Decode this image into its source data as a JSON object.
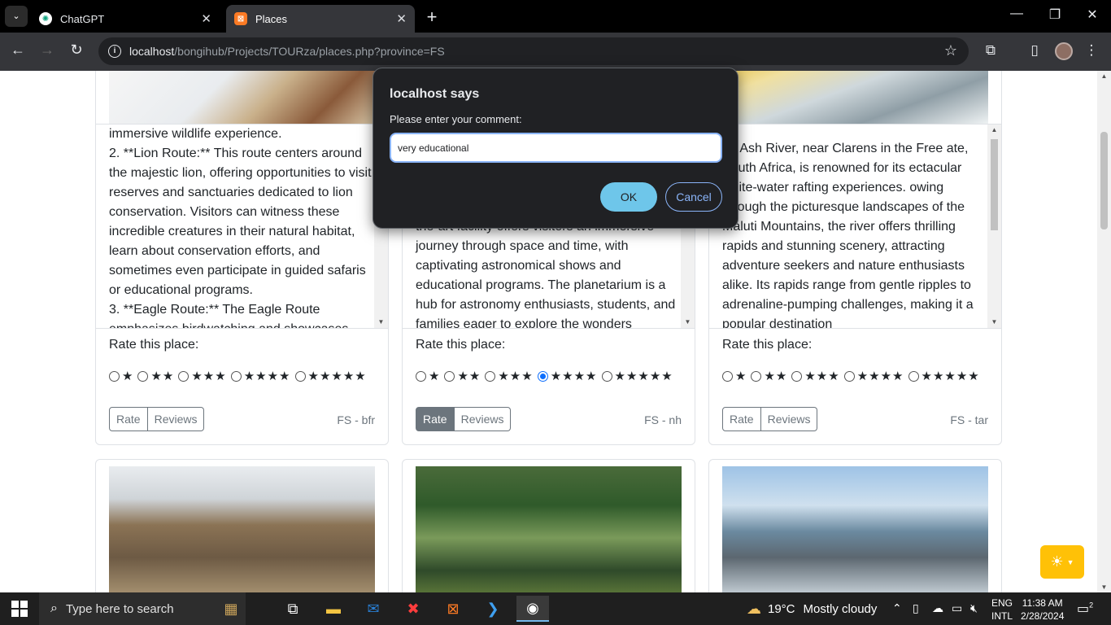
{
  "browser": {
    "tabs": [
      {
        "title": "ChatGPT",
        "icon": "chatgpt-icon"
      },
      {
        "title": "Places",
        "icon": "xampp-icon"
      }
    ],
    "url_host": "localhost",
    "url_path": "/bongihub/Projects/TOURza/places.php?province=FS"
  },
  "dialog": {
    "title": "localhost says",
    "message": "Please enter your comment:",
    "input_value": "very educational",
    "ok_label": "OK",
    "cancel_label": "Cancel"
  },
  "cards": [
    {
      "description": "immersive wildlife experience.\n2. **Lion Route:** This route centers around the majestic lion, offering opportunities to visit reserves and sanctuaries dedicated to lion conservation. Visitors can witness these incredible creatures in their natural habitat, learn about conservation efforts, and sometimes even participate in guided safaris or educational programs.\n3. **Eagle Route:** The Eagle Route emphasizes birdwatching and showcases",
      "rate_label": "Rate this place:",
      "rating_options": [
        "★",
        "★★",
        "★★★",
        "★★★★",
        "★★★★★"
      ],
      "selected_rating": null,
      "rate_button": "Rate",
      "reviews_button": "Reviews",
      "code": "FS - bfr"
    },
    {
      "description": "the-art facility offers visitors an immersive journey through space and time, with captivating astronomical shows and educational programs. The planetarium is a hub for astronomy enthusiasts, students, and families eager to explore the wonders",
      "rate_label": "Rate this place:",
      "rating_options": [
        "★",
        "★★",
        "★★★",
        "★★★★",
        "★★★★★"
      ],
      "selected_rating": 4,
      "rate_button": "Rate",
      "reviews_button": "Reviews",
      "code": "FS - nh"
    },
    {
      "description": "he Ash River, near Clarens in the Free ate, South Africa, is renowned for its ectacular white-water rafting experiences. owing through the picturesque landscapes of the Maluti Mountains, the river offers thrilling rapids and stunning scenery, attracting adventure seekers and nature enthusiasts alike. Its rapids range from gentle ripples to adrenaline-pumping challenges, making it a popular destination",
      "rate_label": "Rate this place:",
      "rating_options": [
        "★",
        "★★",
        "★★★",
        "★★★★",
        "★★★★★"
      ],
      "selected_rating": null,
      "rate_button": "Rate",
      "reviews_button": "Reviews",
      "code": "FS - tar"
    }
  ],
  "theme_icon": "sun-icon",
  "taskbar": {
    "search_placeholder": "Type here to search",
    "weather_temp": "19°C",
    "weather_text": "Mostly cloudy",
    "lang_line1": "ENG",
    "lang_line2": "INTL",
    "time": "11:38 AM",
    "date": "2/28/2024",
    "notification_count": "2"
  },
  "colors": {
    "dialog_bg": "#202124",
    "ok_button": "#6ec6ea",
    "theme_button": "#ffc107",
    "active_rate": "#6c757d"
  }
}
